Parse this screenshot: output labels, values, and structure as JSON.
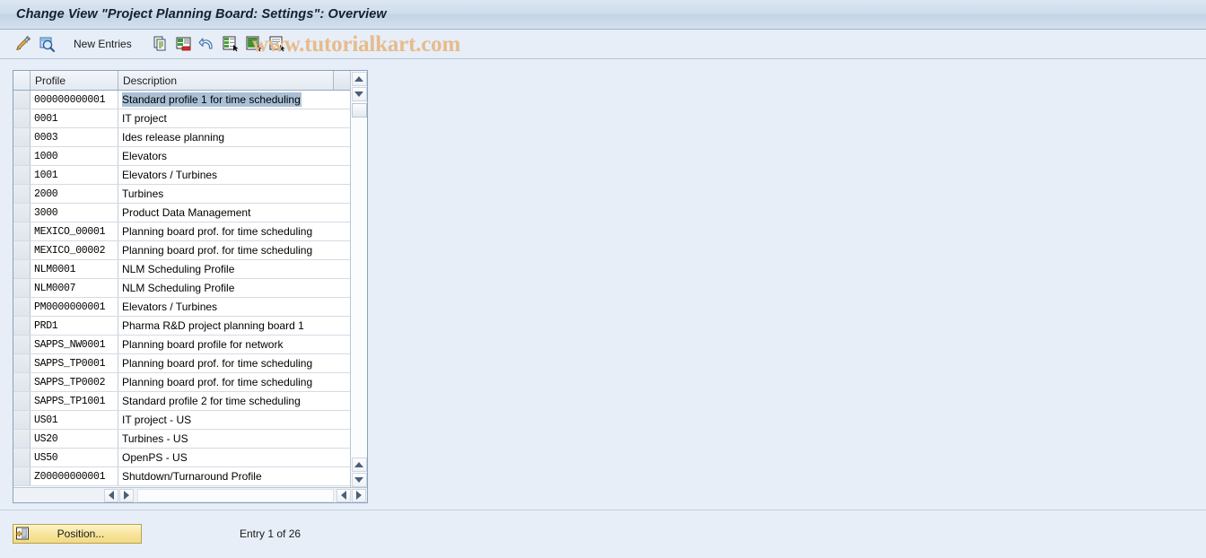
{
  "window": {
    "title": "Change View \"Project Planning Board: Settings\": Overview"
  },
  "toolbar": {
    "icons_left": [
      {
        "name": "edit-pencil-icon",
        "label": "Change"
      },
      {
        "name": "display-magnifier-icon",
        "label": "Display"
      }
    ],
    "new_entries_label": "New Entries",
    "icons_right": [
      {
        "name": "copy-icon",
        "label": "Copy As"
      },
      {
        "name": "delete-row-icon",
        "label": "Delete"
      },
      {
        "name": "undo-icon",
        "label": "Undo Change"
      },
      {
        "name": "select-all-icon",
        "label": "Select All"
      },
      {
        "name": "deselect-all-icon",
        "label": "Deselect All"
      },
      {
        "name": "select-block-icon",
        "label": "Select Block"
      }
    ],
    "watermark": "www.tutorialkart.com"
  },
  "table": {
    "columns": [
      "Profile",
      "Description"
    ],
    "selected_row_index": 0,
    "rows": [
      {
        "profile": "000000000001",
        "description": "Standard profile 1 for time scheduling"
      },
      {
        "profile": "0001",
        "description": "IT project"
      },
      {
        "profile": "0003",
        "description": "Ides release planning"
      },
      {
        "profile": "1000",
        "description": "Elevators"
      },
      {
        "profile": "1001",
        "description": "Elevators / Turbines"
      },
      {
        "profile": "2000",
        "description": "Turbines"
      },
      {
        "profile": "3000",
        "description": "Product Data Management"
      },
      {
        "profile": "MEXICO_00001",
        "description": "Planning board prof. for time scheduling"
      },
      {
        "profile": "MEXICO_00002",
        "description": "Planning board prof. for time scheduling"
      },
      {
        "profile": "NLM0001",
        "description": "NLM Scheduling Profile"
      },
      {
        "profile": "NLM0007",
        "description": "NLM Scheduling Profile"
      },
      {
        "profile": "PM0000000001",
        "description": "Elevators / Turbines"
      },
      {
        "profile": "PRD1",
        "description": "Pharma R&D project planning board 1"
      },
      {
        "profile": "SAPPS_NW0001",
        "description": "Planning board profile for network"
      },
      {
        "profile": "SAPPS_TP0001",
        "description": "Planning board prof. for time scheduling"
      },
      {
        "profile": "SAPPS_TP0002",
        "description": "Planning board prof. for time scheduling"
      },
      {
        "profile": "SAPPS_TP1001",
        "description": "Standard profile 2 for time scheduling"
      },
      {
        "profile": "US01",
        "description": "IT project - US"
      },
      {
        "profile": "US20",
        "description": "Turbines - US"
      },
      {
        "profile": "US50",
        "description": "OpenPS - US"
      },
      {
        "profile": "Z00000000001",
        "description": "Shutdown/Turnaround Profile"
      }
    ]
  },
  "footer": {
    "position_button_label": "Position...",
    "entry_status": "Entry 1 of 26"
  },
  "colors": {
    "page_background": "#e7eef7",
    "title_bar": "#cddbeb",
    "selection_highlight": "#a9c0d6",
    "button_yellow": "#f7e49a",
    "watermark": "#e7bb8c"
  }
}
